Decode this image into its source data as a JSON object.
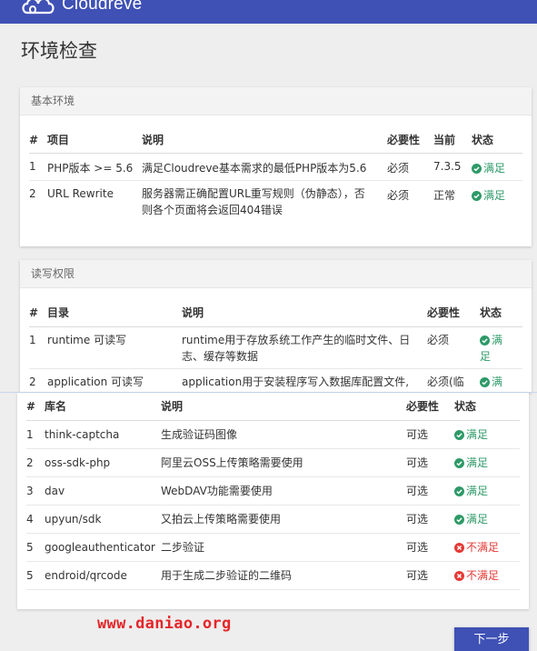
{
  "app": {
    "name": "Cloudreve",
    "brand_color": "#3f51b5"
  },
  "page_title": "环境检查",
  "basic_env": {
    "title": "基本环境",
    "headers": [
      "#",
      "项目",
      "说明",
      "必要性",
      "当前",
      "状态"
    ],
    "rows": [
      {
        "num": "1",
        "item": "PHP版本 >= 5.6",
        "desc1": "满足Cloudreve基本需求的最低PHP版本为5.6",
        "desc2": "",
        "need": "必须",
        "current": "7.3.5",
        "status": "满足"
      },
      {
        "num": "2",
        "item": "URL Rewrite",
        "desc1": "服务器需正确配置URL重写规则（伪静态），否",
        "desc2": "则各个页面将会返回404错误",
        "need": "必须",
        "current": "正常",
        "status": "满足"
      }
    ]
  },
  "rw_perm": {
    "title": "读写权限",
    "headers": [
      "#",
      "目录",
      "说明",
      "必要性",
      "状态"
    ],
    "rows": [
      {
        "num": "1",
        "dir": "runtime 可读写",
        "desc1": "runtime用于存放系统工作产生的临时文件、日",
        "desc2": "志、缓存等数据",
        "need": "必须",
        "status1": "满",
        "status2": "足"
      },
      {
        "num": "2",
        "dir": "application 可读写",
        "desc1": "application用于安装程序写入数据库配置文件,",
        "desc2": "",
        "need": "必须(临",
        "status1": "满",
        "status2": ""
      }
    ]
  },
  "libs": {
    "headers": [
      "#",
      "库名",
      "说明",
      "必要性",
      "状态"
    ],
    "rows": [
      {
        "num": "1",
        "name": "think-captcha",
        "desc": "生成验证码图像",
        "need": "可选",
        "status": "满足",
        "ok": true
      },
      {
        "num": "2",
        "name": "oss-sdk-php",
        "desc": "阿里云OSS上传策略需要使用",
        "need": "可选",
        "status": "满足",
        "ok": true
      },
      {
        "num": "3",
        "name": "dav",
        "desc": "WebDAV功能需要使用",
        "need": "可选",
        "status": "满足",
        "ok": true
      },
      {
        "num": "4",
        "name": "upyun/sdk",
        "desc": "又拍云上传策略需要使用",
        "need": "可选",
        "status": "满足",
        "ok": true
      },
      {
        "num": "5",
        "name": "googleauthenticator",
        "desc": "二步验证",
        "need": "可选",
        "status": "不满足",
        "ok": false
      },
      {
        "num": "5",
        "name": "endroid/qrcode",
        "desc": "用于生成二步验证的二维码",
        "need": "可选",
        "status": "不满足",
        "ok": false
      }
    ]
  },
  "watermark": "www.daniao.org",
  "next_button": "下一步",
  "colors": {
    "ok": "#2e9a68",
    "bad": "#e53935",
    "watermark": "#e4262a"
  }
}
